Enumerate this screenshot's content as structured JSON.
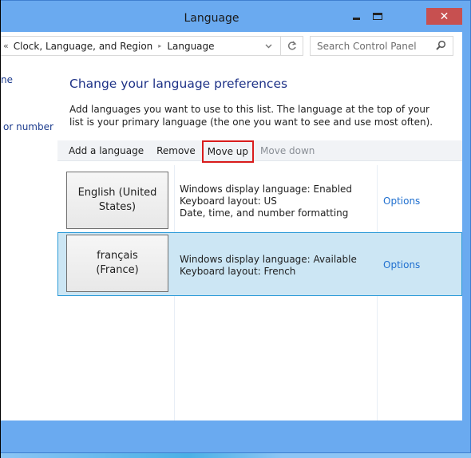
{
  "window": {
    "title": "Language",
    "minimize_label": "Minimize",
    "maximize_label": "Maximize",
    "close_glyph": "✕"
  },
  "address_bar": {
    "overflow_glyph": "«",
    "breadcrumbs": [
      "Clock, Language, and Region",
      "Language"
    ],
    "separator_glyph": "▸",
    "dropdown_glyph": "⌄",
    "refresh_glyph": "↻",
    "search_placeholder": "Search Control Panel"
  },
  "sidebar": {
    "links": [
      "ne",
      "or number"
    ]
  },
  "main": {
    "title": "Change your language preferences",
    "description": "Add languages you want to use to this list. The language at the top of your list is your primary language (the one you want to see and use most often).",
    "toolbar": {
      "add_language": "Add a language",
      "remove": "Remove",
      "move_up": "Move up",
      "move_down": "Move down"
    },
    "languages": [
      {
        "name": "English (United States)",
        "details": [
          "Windows display language: Enabled",
          "Keyboard layout: US",
          "Date, time, and number formatting"
        ],
        "options_label": "Options",
        "selected": false
      },
      {
        "name": "français (France)",
        "details": [
          "Windows display language: Available",
          "Keyboard layout: French"
        ],
        "options_label": "Options",
        "selected": true
      }
    ]
  },
  "colors": {
    "title_bar": "#6aaaf0",
    "close_button": "#c75050",
    "heading": "#1e3287",
    "link": "#1f6fcf",
    "selected_row": "#cce6f4",
    "selected_border": "#2d9bd8",
    "highlight_box": "#d91c1c"
  }
}
